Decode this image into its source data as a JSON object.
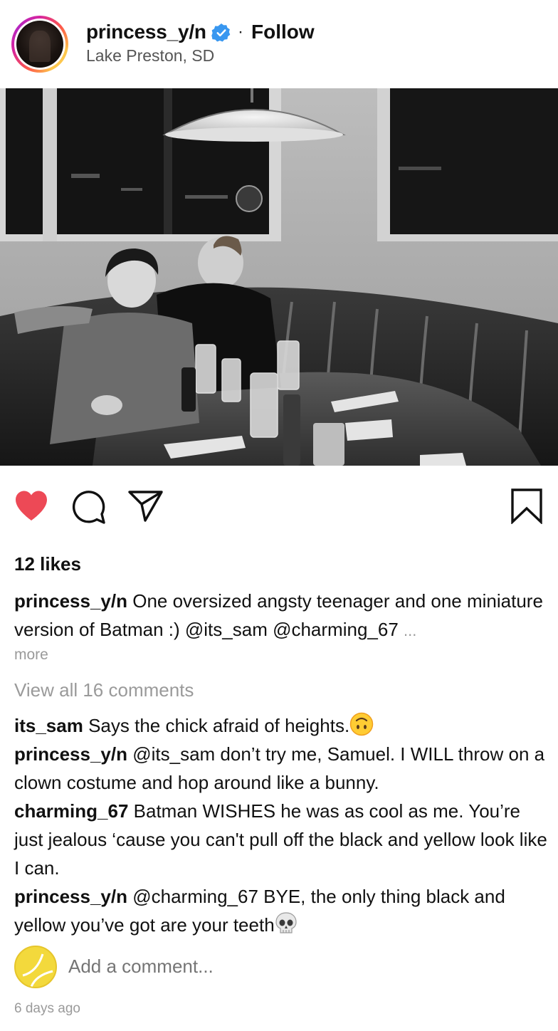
{
  "post": {
    "username": "princess_y/n",
    "separator": "·",
    "follow_label": "Follow",
    "location": "Lake Preston, SD",
    "likes": "12 likes",
    "caption": {
      "author": "princess_y/n",
      "text": "One oversized angsty teenager and one miniature version of Batman :) @its_sam @charming_67",
      "ellipsis": "...",
      "more_label": "more"
    },
    "view_all_label": "View all 16 comments",
    "comments": [
      {
        "author": "its_sam",
        "text": "Says the chick afraid of heights.",
        "emoji": "upside-down-face"
      },
      {
        "author": "princess_y/n",
        "text": "@its_sam don’t try me, Samuel. I WILL throw on a clown costume and hop around like a bunny."
      },
      {
        "author": "charming_67",
        "text": "Batman WISHES he was as cool as me. You’re just jealous ‘cause you can't pull off the black and yellow look like I can."
      },
      {
        "author": "princess_y/n",
        "text": "@charming_67 BYE, the only thing black and yellow you’ve got are your teeth",
        "emoji": "skull"
      }
    ],
    "add_comment_placeholder": "Add a comment...",
    "timestamp": "6 days ago"
  },
  "colors": {
    "like_red": "#ed4956",
    "verified_blue": "#3897f0",
    "muted_gray": "#9a9a9a"
  },
  "icons": {
    "verified": "verified-badge-icon",
    "like": "heart-icon",
    "comment": "comment-bubble-icon",
    "share": "paper-plane-icon",
    "save": "bookmark-icon"
  }
}
